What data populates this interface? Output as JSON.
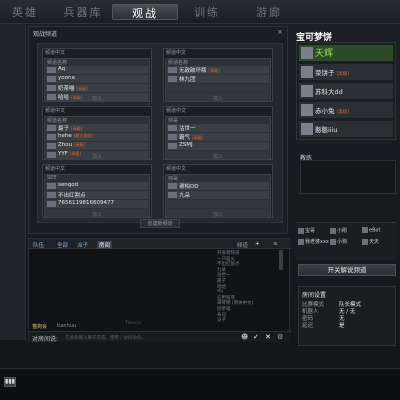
{
  "nav": {
    "tabs": [
      "英雄",
      "兵器库",
      "观战",
      "训练",
      "游廊"
    ],
    "active_index": 2
  },
  "main": {
    "title": "观战频道",
    "close": "×",
    "add_button": "创建新频道",
    "cards": [
      {
        "header": "频道中文",
        "left": {
          "hdr": "频道名称",
          "players": [
            {
              "name": "Aq",
              "tag": ""
            },
            {
              "name": "yoona",
              "tag": ""
            },
            {
              "name": "奶茶喵",
              "tag": "[高级]"
            },
            {
              "name": "哈哈",
              "tag": "[高级]"
            }
          ],
          "join": "加入"
        },
        "right": {
          "hdr": "频道名称",
          "players": [
            {
              "name": "无敌破坏瓶",
              "tag": "[高级]"
            },
            {
              "name": "林九团",
              "tag": ""
            },
            {
              "name": "",
              "tag": ""
            },
            {
              "name": "",
              "tag": ""
            }
          ],
          "join": "加入"
        }
      },
      {
        "header": "频道中文",
        "left": {
          "hdr": "频道名称",
          "players": [
            {
              "name": "最子",
              "tag": "[高级]"
            },
            {
              "name": "hehe",
              "tag": "[最大高级]"
            },
            {
              "name": "Zhou",
              "tag": "[高级]"
            },
            {
              "name": "YYF",
              "tag": "[高级]"
            }
          ],
          "join": "加入"
        },
        "right": {
          "hdr": "帅哥",
          "players": [
            {
              "name": "沽世一",
              "tag": ""
            },
            {
              "name": "霸气",
              "tag": "[高级]"
            },
            {
              "name": "ZSMJ",
              "tag": ""
            },
            {
              "name": "",
              "tag": ""
            }
          ],
          "join": "加入"
        }
      },
      {
        "header": "频道中文",
        "left": {
          "hdr": "SEE",
          "players": [
            {
              "name": "senqod",
              "tag": ""
            },
            {
              "name": "不出红割点",
              "tag": ""
            },
            {
              "name": "7656119816609477",
              "tag": ""
            },
            {
              "name": "",
              "tag": ""
            }
          ],
          "join": "加入"
        },
        "right": {
          "hdr": "帅哥",
          "players": [
            {
              "name": "谢柏DD",
              "tag": ""
            },
            {
              "name": "九朵",
              "tag": ""
            },
            {
              "name": "",
              "tag": ""
            },
            {
              "name": "",
              "tag": ""
            }
          ],
          "join": "加入"
        }
      }
    ]
  },
  "chat": {
    "tabs": [
      "队伍",
      "全部",
      "派子",
      "房间"
    ],
    "active_tab": 3,
    "extra": "频道",
    "channels": [
      "开发者频道",
      "一只猫火",
      "不出红割点",
      "九朵",
      "沽世一",
      "最子",
      "哈哈",
      "Aq",
      "应用程序",
      "海琴锦 (简体中文)",
      "奶茶喵",
      "寿司",
      "派子"
    ],
    "input_label": "对房间说:",
    "input_placeholder": "在此处输入聊天内容。使用 / 访问命令。",
    "scroll_label": "Tiancal",
    "footer_name": "猫狗会",
    "footer_sub": "tianhuu"
  },
  "right": {
    "title": "宝可梦饼",
    "players": [
      {
        "name": "天辉",
        "tag": ""
      },
      {
        "name": "菜饼子",
        "tag": "[高级]"
      },
      {
        "name": "苏科大dd",
        "tag": ""
      },
      {
        "name": "赤小兔",
        "tag": "[高级]"
      },
      {
        "name": "憨憨iiiu",
        "tag": ""
      }
    ],
    "join": "加入",
    "coach_label": "教练",
    "spectators": [
      {
        "name": "宝哥"
      },
      {
        "name": "小刚"
      },
      {
        "name": "eBot"
      },
      {
        "name": "我老婆xxx"
      },
      {
        "name": "小狗"
      },
      {
        "name": "天天"
      }
    ],
    "open_button": "开关解说频道",
    "settings": {
      "title": "房间设置",
      "rows": [
        [
          "比赛模式",
          "队长模式"
        ],
        [
          "机器人",
          "无 / 无"
        ],
        [
          "密码",
          "无"
        ],
        [
          "延迟",
          "是"
        ]
      ]
    }
  }
}
